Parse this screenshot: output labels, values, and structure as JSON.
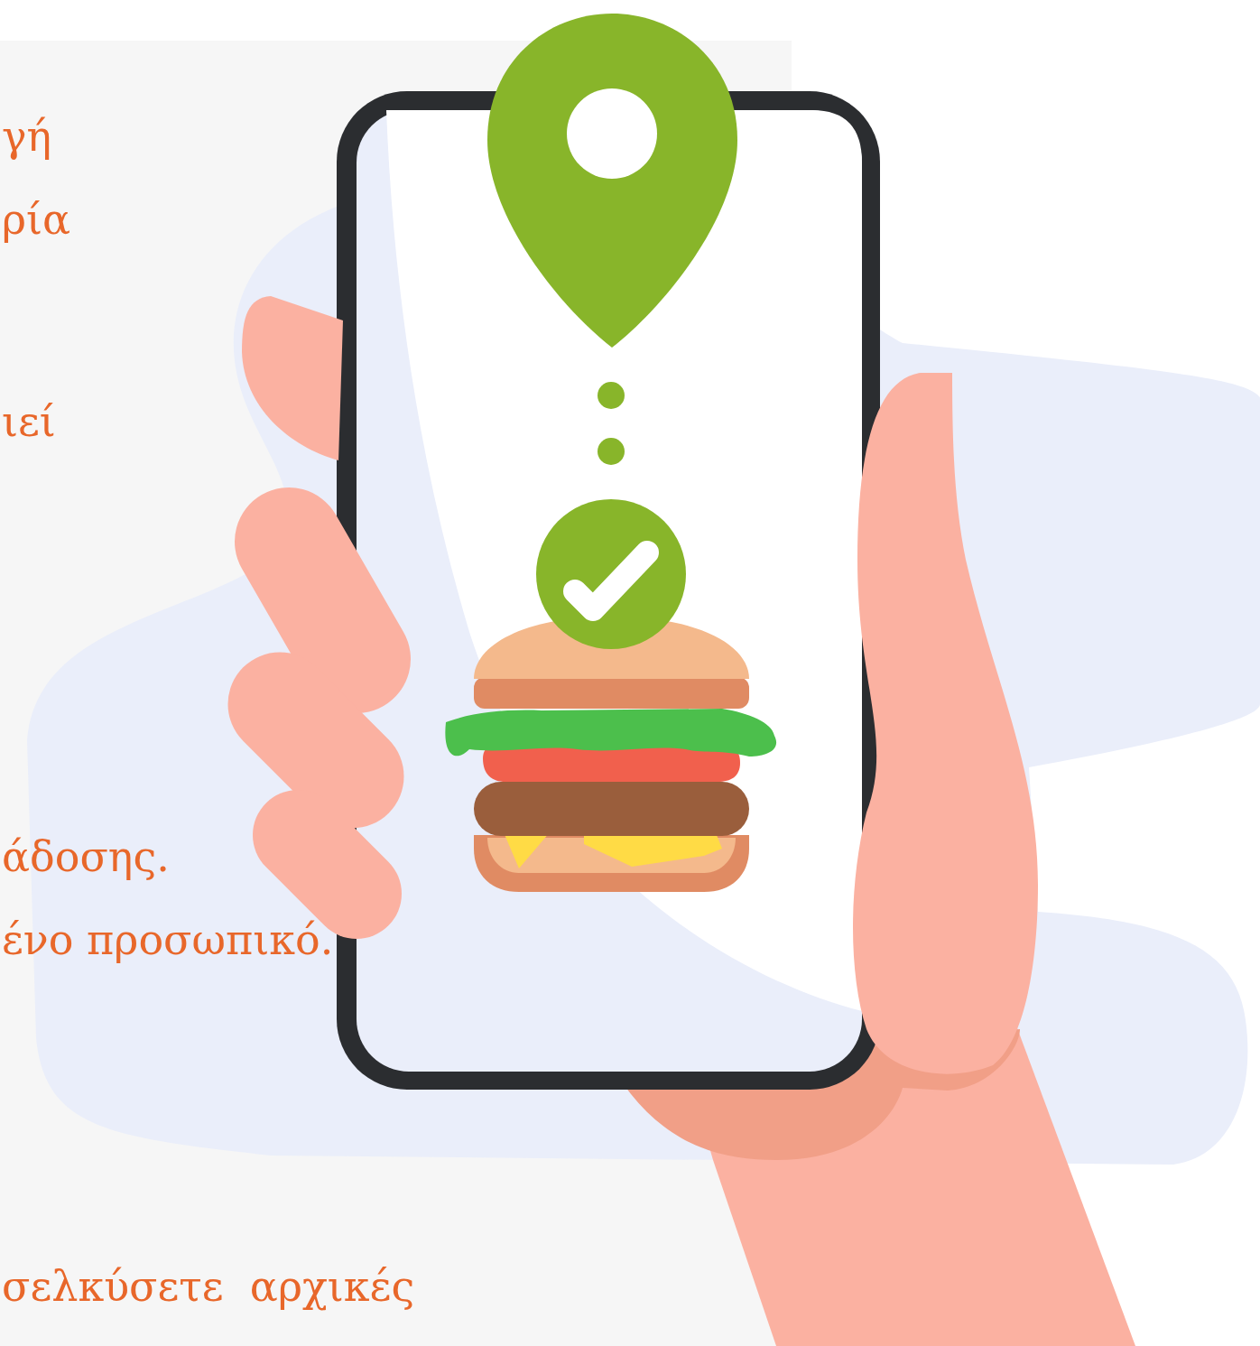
{
  "paragraphs": [
    {
      "lines": [
        "γή",
        "ρία"
      ]
    },
    {
      "lines": [
        "ιεί"
      ]
    },
    {
      "lines": [
        "άδοσης.",
        "ένο προσωπικό."
      ]
    },
    {
      "lines": [
        "σελκύσετε  αρχικές"
      ]
    }
  ]
}
